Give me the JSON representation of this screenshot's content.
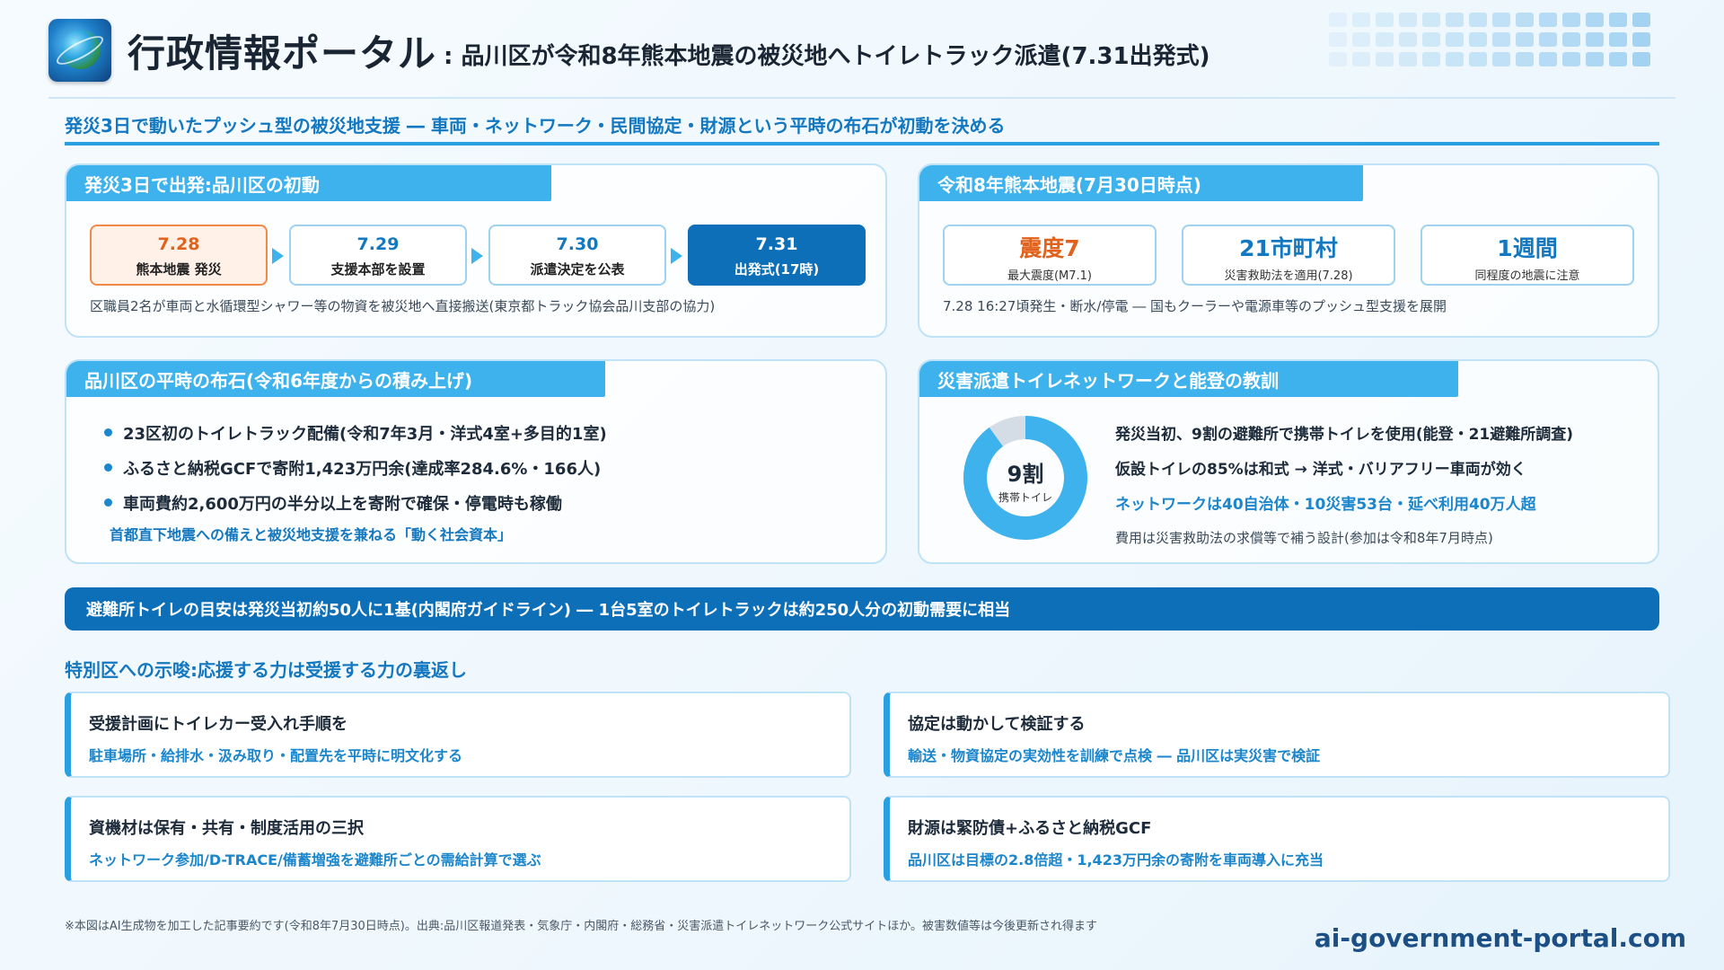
{
  "header": {
    "title": "行政情報ポータル",
    "subtitle": ": 品川区が令和8年熊本地震の被災地へトイレトラック派遣(7.31出発式)"
  },
  "section_heading": "発災3日で動いたプッシュ型の被災地支援 ― 車両・ネットワーク・民間協定・財源という平時の布石が初動を決める",
  "initial_response": {
    "tab": "発災3日で出発:品川区の初動",
    "timeline": [
      {
        "date": "7.28",
        "label": "熊本地震 発災"
      },
      {
        "date": "7.29",
        "label": "支援本部を設置"
      },
      {
        "date": "7.30",
        "label": "派遣決定を公表"
      },
      {
        "date": "7.31",
        "label": "出発式(17時)"
      }
    ],
    "note": "区職員2名が車両と水循環型シャワー等の物資を被災地へ直接搬送(東京都トラック協会品川支部の協力)"
  },
  "earthquake": {
    "tab": "令和8年熊本地震(7月30日時点)",
    "stats": [
      {
        "value": "震度7",
        "caption": "最大震度(M7.1)"
      },
      {
        "value": "21市町村",
        "caption": "災害救助法を適用(7.28)"
      },
      {
        "value": "1週間",
        "caption": "同程度の地震に注意"
      }
    ],
    "note": "7.28 16:27頃発生・断水/停電 ― 国もクーラーや電源車等のプッシュ型支援を展開"
  },
  "preparation": {
    "tab": "品川区の平時の布石(令和6年度からの積み上げ)",
    "bullets": [
      "23区初のトイレトラック配備(令和7年3月・洋式4室+多目的1室)",
      "ふるさと納税GCFで寄附1,423万円余(達成率284.6%・166人)",
      "車両費約2,600万円の半分以上を寄附で確保・停電時も稼働"
    ],
    "note": "首都直下地震への備えと被災地支援を兼ねる「動く社会資本」"
  },
  "network": {
    "tab": "災害派遣トイレネットワークと能登の教訓",
    "donut_value": "9割",
    "donut_label": "携帯トイレ",
    "donut_fraction": 0.9,
    "lines": [
      "発災当初、9割の避難所で携帯トイレを使用(能登・21避難所調査)",
      "仮設トイレの85%は和式 → 洋式・バリアフリー車両が効く",
      "ネットワークは40自治体・10災害53台・延べ利用40万人超",
      "費用は災害救助法の求償等で補う設計(参加は令和8年7月時点)"
    ]
  },
  "banner": "避難所トイレの目安は発災当初約50人に1基(内閣府ガイドライン) ― 1台5室のトイレトラックは約250人分の初動需要に相当",
  "implications": {
    "heading": "特別区への示唆:応援する力は受援する力の裏返し",
    "cards": [
      {
        "title": "受援計画にトイレカー受入れ手順を",
        "sub": "駐車場所・給排水・汲み取り・配置先を平時に明文化する"
      },
      {
        "title": "協定は動かして検証する",
        "sub": "輸送・物資協定の実効性を訓練で点検 ― 品川区は実災害で検証"
      },
      {
        "title": "資機材は保有・共有・制度活用の三択",
        "sub": "ネットワーク参加/D-TRACE/備蓄増強を避難所ごとの需給計算で選ぶ"
      },
      {
        "title": "財源は緊防債+ふるさと納税GCF",
        "sub": "品川区は目標の2.8倍超・1,423万円余の寄附を車両導入に充当"
      }
    ]
  },
  "footnote": "※本図はAI生成物を加工した記事要約です(令和8年7月30日時点)。出典:品川区報道発表・気象庁・内閣府・総務省・災害派遣トイレネットワーク公式サイトほか。被害数値等は今後更新され得ます",
  "site": "ai-government-portal.com",
  "colors": {
    "accent": "#1478c0",
    "banner": "#0d6fb8",
    "tab": "#3db2ec",
    "warn": "#e0621d"
  }
}
